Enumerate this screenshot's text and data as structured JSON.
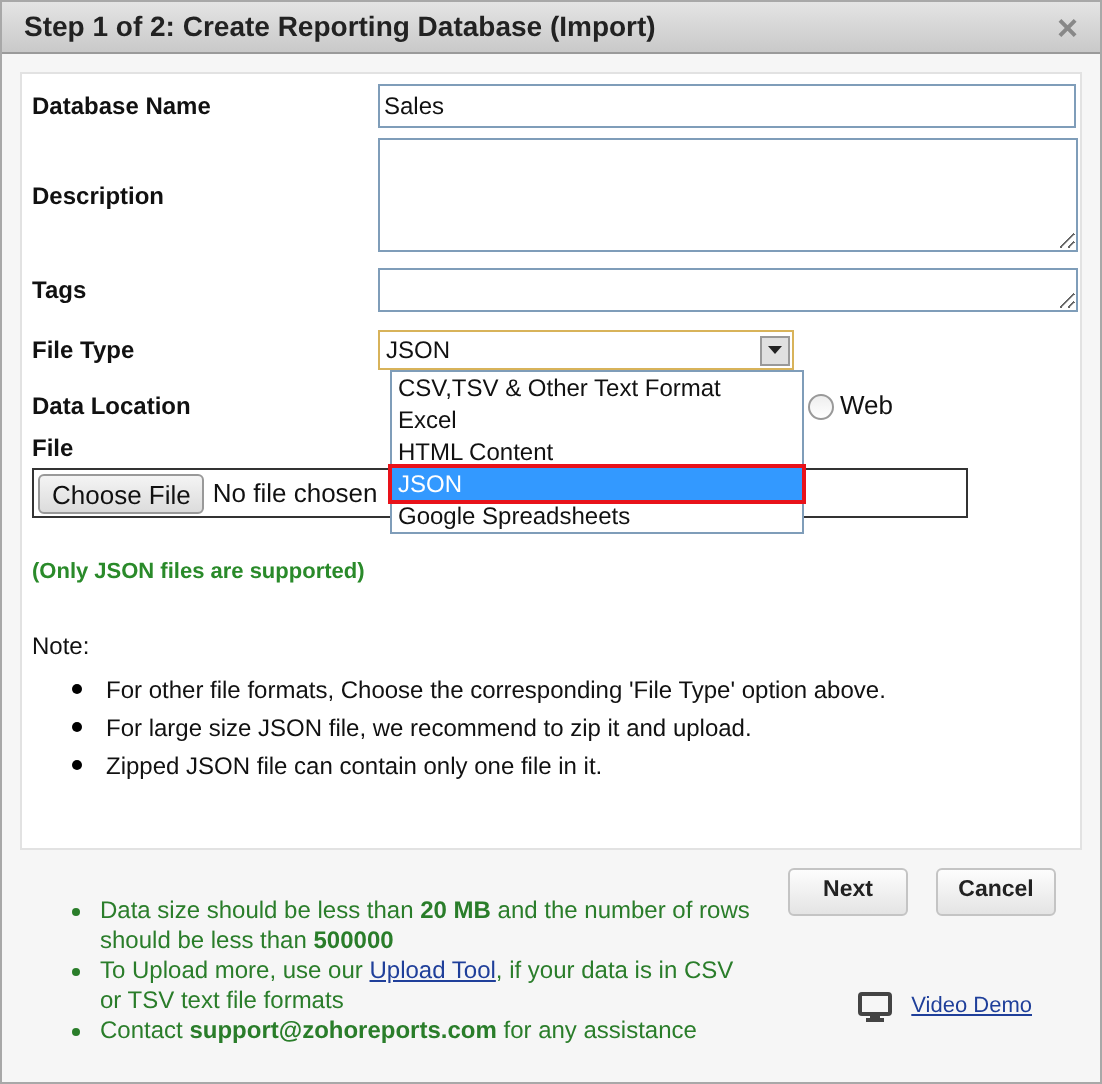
{
  "window": {
    "title": "Step 1 of 2: Create Reporting Database (Import)",
    "close": "×"
  },
  "form": {
    "database_name": {
      "label": "Database Name",
      "value": "Sales"
    },
    "description": {
      "label": "Description"
    },
    "tags": {
      "label": "Tags"
    },
    "file_type": {
      "label": "File Type",
      "value": "JSON",
      "options": [
        {
          "label": "CSV,TSV & Other Text Format",
          "selected": false
        },
        {
          "label": "Excel",
          "selected": false
        },
        {
          "label": "HTML Content",
          "selected": false
        },
        {
          "label": "JSON",
          "selected": true
        },
        {
          "label": "Google Spreadsheets",
          "selected": false
        }
      ]
    },
    "data_location": {
      "label": "Data Location",
      "options": [
        {
          "label": "Web",
          "selected": false
        }
      ]
    },
    "file": {
      "label": "File",
      "button": "Choose File",
      "status": "No file chosen"
    },
    "support_note": "(Only JSON files are supported)",
    "note": {
      "heading": "Note:",
      "items": [
        "For other file formats, Choose the corresponding 'File Type' option above.",
        "For large size JSON file, we recommend to zip it and upload.",
        "Zipped JSON file can contain only one file in it."
      ]
    }
  },
  "footer": {
    "notes": [
      {
        "kind": "text",
        "text": "Data size should be less than **20 MB** and the number of rows should be less than **500000**"
      },
      {
        "kind": "link",
        "before": "To Upload more, use our",
        "link": "Upload Tool",
        "after": ", if your data is in CSV or TSV text file formats"
      },
      {
        "kind": "text",
        "text": "Contact **support@zohoreports.com** for any assistance"
      }
    ],
    "buttons": [
      "Next",
      "Cancel"
    ],
    "video_link": "Video Demo"
  }
}
